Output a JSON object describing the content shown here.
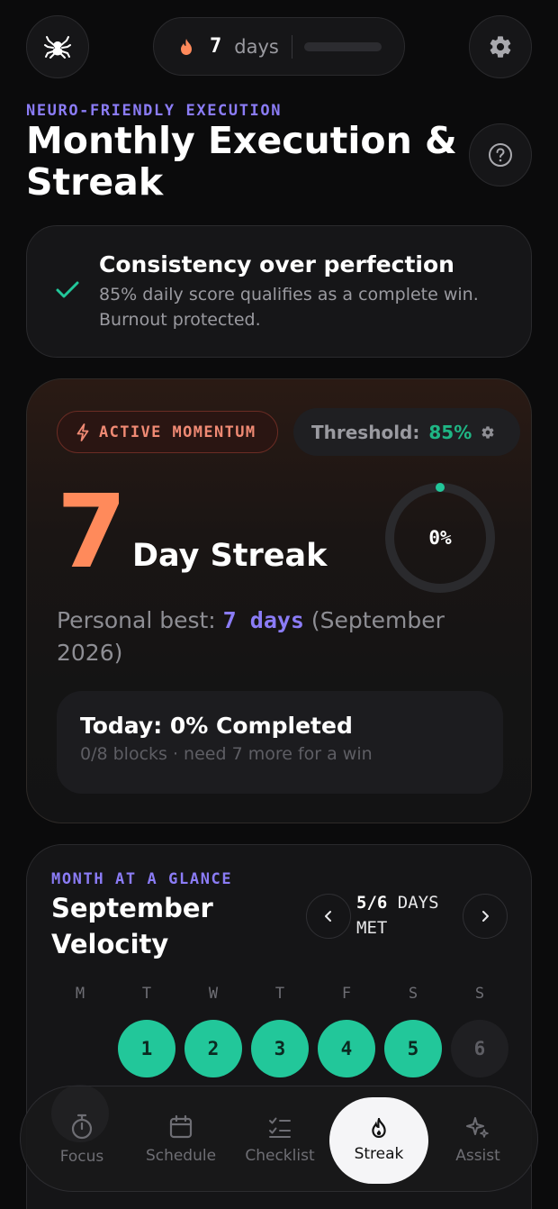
{
  "topbar": {
    "logo_icon": "spider-icon",
    "streak_pill": {
      "icon": "flame-icon",
      "count": "7",
      "unit": "days",
      "progress": 0
    },
    "settings_icon": "gear-icon"
  },
  "header": {
    "eyebrow": "NEURO-FRIENDLY EXECUTION",
    "title": "Monthly Execution & Streak",
    "help_icon": "question-icon"
  },
  "info_card": {
    "icon": "check-icon",
    "title": "Consistency over perfection",
    "description": "85% daily score qualifies as a complete win. Burnout protected."
  },
  "momentum": {
    "badge": "ACTIVE MOMENTUM",
    "threshold_label": "Threshold:",
    "threshold_value": "85%",
    "streak_number": "7",
    "streak_label": "Day Streak",
    "ring_value": 0,
    "ring_label": "0%",
    "best_prefix": "Personal best: ",
    "best_value": "7 days",
    "best_suffix": " (September 2026)",
    "today_title": "Today: 0% Completed",
    "today_sub": "0/8 blocks · need 7 more for a win"
  },
  "month": {
    "eyebrow": "MONTH AT A GLANCE",
    "title": "September Velocity",
    "days_met_count": "5/6",
    "days_met_label": " DAYS MET",
    "weekdays": [
      "M",
      "T",
      "W",
      "T",
      "F",
      "S",
      "S"
    ],
    "days": [
      {
        "label": "1",
        "status": "met"
      },
      {
        "label": "2",
        "status": "met"
      },
      {
        "label": "3",
        "status": "met"
      },
      {
        "label": "4",
        "status": "met"
      },
      {
        "label": "5",
        "status": "met"
      },
      {
        "label": "6",
        "status": "pending"
      }
    ]
  },
  "bottom_nav": {
    "items": [
      {
        "label": "Focus",
        "icon": "stopwatch-icon",
        "active": false
      },
      {
        "label": "Schedule",
        "icon": "calendar-icon",
        "active": false
      },
      {
        "label": "Checklist",
        "icon": "checklist-icon",
        "active": false
      },
      {
        "label": "Streak",
        "icon": "flame-icon",
        "active": true
      },
      {
        "label": "Assist",
        "icon": "sparkle-icon",
        "active": false
      }
    ]
  },
  "colors": {
    "accent_purple": "#8b7cf6",
    "accent_orange": "#ff8a5b",
    "success_green": "#22c79a"
  }
}
